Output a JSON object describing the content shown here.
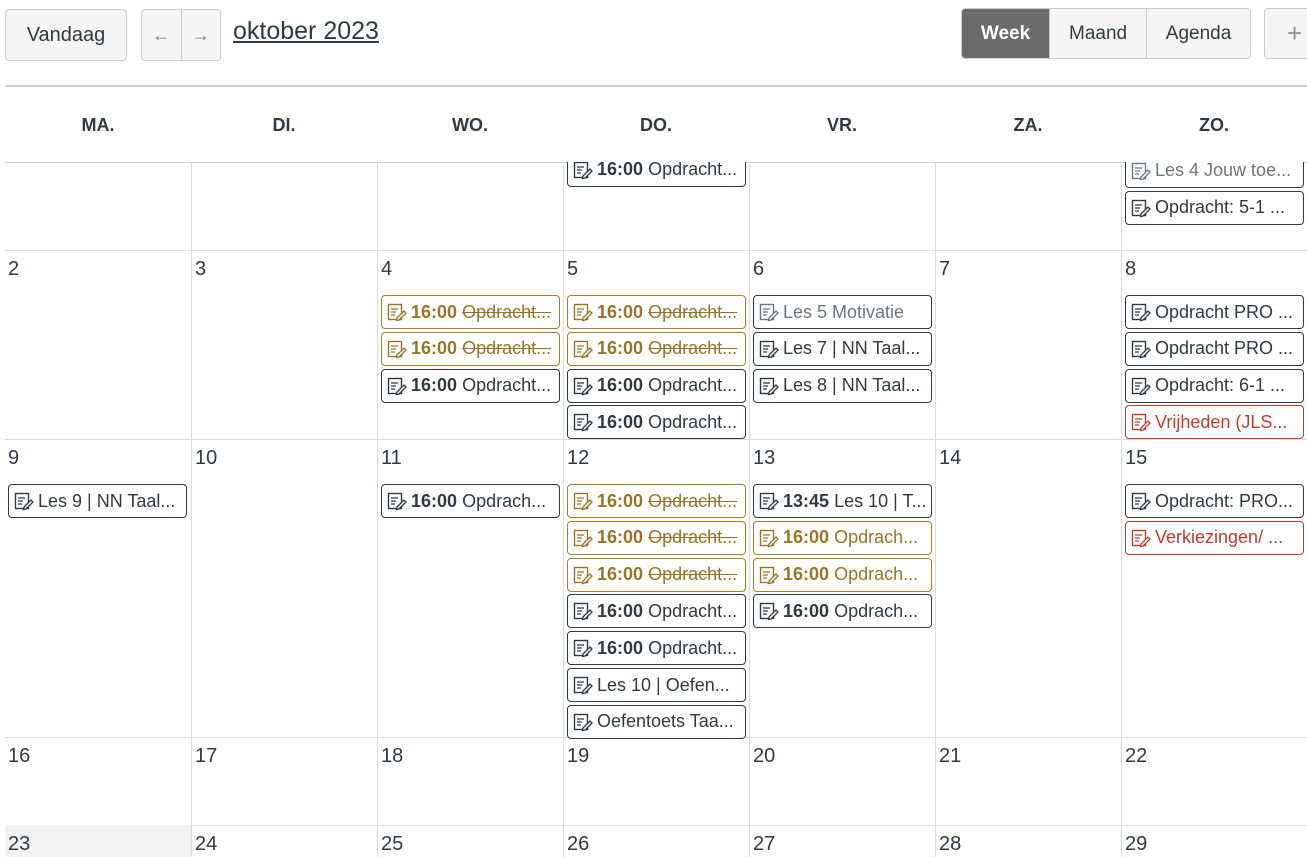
{
  "toolbar": {
    "today_label": "Vandaag",
    "prev_icon": "←",
    "next_icon": "→",
    "title": "oktober 2023",
    "views": [
      "Week",
      "Maand",
      "Agenda"
    ],
    "active_view": "Week",
    "add_icon": "+"
  },
  "weekdays": [
    "MA.",
    "DI.",
    "WO.",
    "DO.",
    "VR.",
    "ZA.",
    "ZO."
  ],
  "colors": {
    "gold": "#9a7424",
    "red": "#c23c2d",
    "text": "#2d3b45",
    "muted": "#6b7780",
    "active_view_bg": "#6b6b6b"
  },
  "weeks": [
    {
      "days": [
        {
          "num": "",
          "events": []
        },
        {
          "num": "",
          "events": []
        },
        {
          "num": "",
          "events": [
            {
              "style": "dark",
              "time": "",
              "title": ""
            }
          ]
        },
        {
          "num": "",
          "events": [
            {
              "style": "gold",
              "time": "",
              "title": ""
            },
            {
              "style": "dark",
              "time": "16:00",
              "title": "Opdracht..."
            }
          ]
        },
        {
          "num": "",
          "events": []
        },
        {
          "num": "",
          "events": []
        },
        {
          "num": "",
          "events": [
            {
              "style": "dark",
              "time": "",
              "title": ""
            },
            {
              "style": "gray",
              "time": "",
              "title": "Les 4 Jouw toe..."
            },
            {
              "style": "dark",
              "time": "",
              "title": "Opdracht: 5-1 ..."
            }
          ]
        }
      ]
    },
    {
      "days": [
        {
          "num": "2",
          "events": []
        },
        {
          "num": "3",
          "events": []
        },
        {
          "num": "4",
          "events": [
            {
              "style": "gold",
              "time": "16:00",
              "title": "Opdracht...",
              "strike": true
            },
            {
              "style": "gold",
              "time": "16:00",
              "title": "Opdracht...",
              "strike": true
            },
            {
              "style": "dark",
              "time": "16:00",
              "title": "Opdracht..."
            }
          ]
        },
        {
          "num": "5",
          "events": [
            {
              "style": "gold",
              "time": "16:00",
              "title": "Opdracht...",
              "strike": true
            },
            {
              "style": "gold",
              "time": "16:00",
              "title": "Opdracht...",
              "strike": true
            },
            {
              "style": "dark",
              "time": "16:00",
              "title": "Opdracht..."
            },
            {
              "style": "dark",
              "time": "16:00",
              "title": "Opdracht..."
            }
          ]
        },
        {
          "num": "6",
          "events": [
            {
              "style": "gray",
              "time": "",
              "title": "Les 5 Motivatie"
            },
            {
              "style": "dark",
              "time": "",
              "title": "Les 7 | NN Taal..."
            },
            {
              "style": "dark",
              "time": "",
              "title": "Les 8 | NN Taal..."
            }
          ]
        },
        {
          "num": "7",
          "events": []
        },
        {
          "num": "8",
          "events": [
            {
              "style": "dark",
              "time": "",
              "title": "Opdracht PRO ..."
            },
            {
              "style": "dark",
              "time": "",
              "title": "Opdracht PRO ..."
            },
            {
              "style": "dark",
              "time": "",
              "title": "Opdracht: 6-1 ..."
            },
            {
              "style": "red",
              "time": "",
              "title": "Vrijheden (JLS..."
            }
          ]
        }
      ]
    },
    {
      "days": [
        {
          "num": "9",
          "events": [
            {
              "style": "dark",
              "time": "",
              "title": "Les 9 | NN Taal..."
            }
          ]
        },
        {
          "num": "10",
          "events": []
        },
        {
          "num": "11",
          "events": [
            {
              "style": "dark",
              "time": "16:00",
              "title": "Opdrach..."
            }
          ]
        },
        {
          "num": "12",
          "events": [
            {
              "style": "gold",
              "time": "16:00",
              "title": "Opdracht...",
              "strike": true
            },
            {
              "style": "gold",
              "time": "16:00",
              "title": "Opdracht...",
              "strike": true
            },
            {
              "style": "gold",
              "time": "16:00",
              "title": "Opdracht...",
              "strike": true
            },
            {
              "style": "dark",
              "time": "16:00",
              "title": "Opdracht..."
            },
            {
              "style": "dark",
              "time": "16:00",
              "title": "Opdracht..."
            },
            {
              "style": "dark",
              "time": "",
              "title": "Les 10 | Oefen..."
            },
            {
              "style": "dark",
              "time": "",
              "title": "Oefentoets Taa..."
            }
          ]
        },
        {
          "num": "13",
          "events": [
            {
              "style": "dark",
              "time": "13:45",
              "title": "Les 10 | T..."
            },
            {
              "style": "gold",
              "time": "16:00",
              "title": "Opdrach..."
            },
            {
              "style": "gold",
              "time": "16:00",
              "title": "Opdrach..."
            },
            {
              "style": "dark",
              "time": "16:00",
              "title": "Opdrach..."
            }
          ]
        },
        {
          "num": "14",
          "events": []
        },
        {
          "num": "15",
          "events": [
            {
              "style": "dark",
              "time": "",
              "title": "Opdracht: PRO..."
            },
            {
              "style": "red",
              "time": "",
              "title": "Verkiezingen/ ..."
            }
          ]
        }
      ]
    },
    {
      "days": [
        {
          "num": "16",
          "events": []
        },
        {
          "num": "17",
          "events": []
        },
        {
          "num": "18",
          "events": []
        },
        {
          "num": "19",
          "events": []
        },
        {
          "num": "20",
          "events": []
        },
        {
          "num": "21",
          "events": []
        },
        {
          "num": "22",
          "events": []
        }
      ]
    },
    {
      "days": [
        {
          "num": "23",
          "events": [],
          "highlight": true
        },
        {
          "num": "24",
          "events": []
        },
        {
          "num": "25",
          "events": []
        },
        {
          "num": "26",
          "events": []
        },
        {
          "num": "27",
          "events": []
        },
        {
          "num": "28",
          "events": []
        },
        {
          "num": "29",
          "events": []
        }
      ]
    }
  ]
}
